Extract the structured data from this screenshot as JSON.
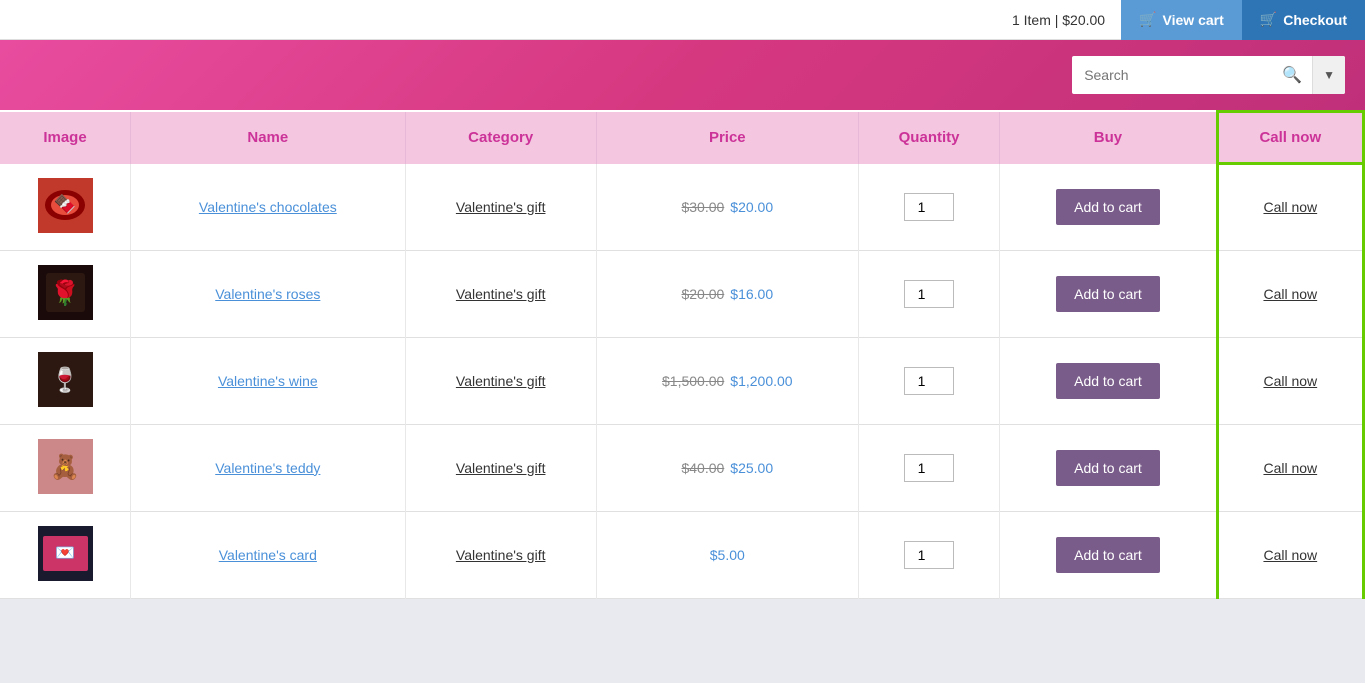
{
  "topbar": {
    "cart_info": "1 Item | $20.00",
    "view_cart_label": "View cart",
    "checkout_label": "Checkout"
  },
  "header": {
    "search_placeholder": "Search"
  },
  "table": {
    "columns": [
      "Image",
      "Name",
      "Category",
      "Price",
      "Quantity",
      "Buy",
      "Call now"
    ],
    "rows": [
      {
        "id": 1,
        "name": "Valentine's chocolates",
        "category": "Valentine's gift",
        "price_original": "$30.00",
        "price_sale": "$20.00",
        "quantity": 1,
        "buy_label": "Add to cart",
        "call_label": "Call now",
        "img_class": "img-choc"
      },
      {
        "id": 2,
        "name": "Valentine's roses",
        "category": "Valentine's gift",
        "price_original": "$20.00",
        "price_sale": "$16.00",
        "quantity": 1,
        "buy_label": "Add to cart",
        "call_label": "Call now",
        "img_class": "img-roses"
      },
      {
        "id": 3,
        "name": "Valentine's wine",
        "category": "Valentine's gift",
        "price_original": "$1,500.00",
        "price_sale": "$1,200.00",
        "quantity": 1,
        "buy_label": "Add to cart",
        "call_label": "Call now",
        "img_class": "img-wine"
      },
      {
        "id": 4,
        "name": "Valentine's teddy",
        "category": "Valentine's gift",
        "price_original": "$40.00",
        "price_sale": "$25.00",
        "quantity": 1,
        "buy_label": "Add to cart",
        "call_label": "Call now",
        "img_class": "img-teddy"
      },
      {
        "id": 5,
        "name": "Valentine's card",
        "category": "Valentine's gift",
        "price_original": null,
        "price_sale": "$5.00",
        "quantity": 1,
        "buy_label": "Add to cart",
        "call_label": "Call now",
        "img_class": "img-card"
      }
    ]
  }
}
